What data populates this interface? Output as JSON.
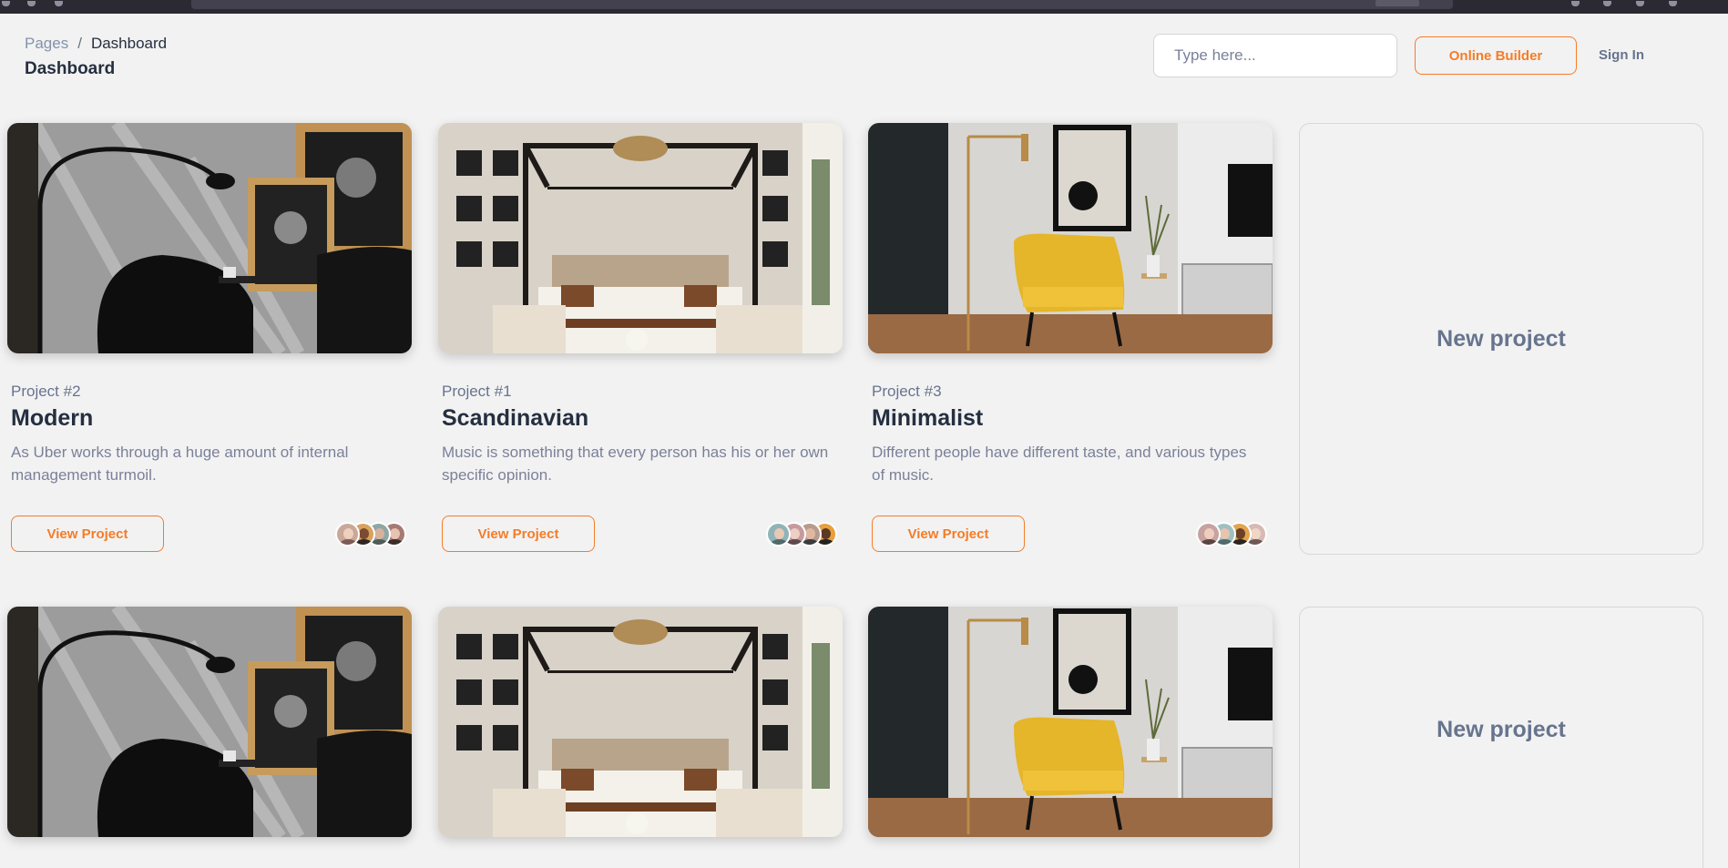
{
  "header": {
    "breadcrumb": {
      "parent": "Pages",
      "separator": "/",
      "current": "Dashboard"
    },
    "title": "Dashboard",
    "search_placeholder": "Type here...",
    "builder_label": "Online Builder",
    "signin_label": "Sign In"
  },
  "colors": {
    "accent": "#f57c27",
    "background": "#f2f2f2",
    "heading": "#252f40",
    "muted": "#7b809a"
  },
  "projects": [
    {
      "number": "Project #2",
      "name": "Modern",
      "description": "As Uber works through a huge amount of internal management turmoil.",
      "button": "View Project",
      "image": "modern-living-room-image",
      "avatars": [
        "#c9a89a",
        "#d9a25c",
        "#8fa7a4",
        "#a67a74"
      ]
    },
    {
      "number": "Project #1",
      "name": "Scandinavian",
      "description": "Music is something that every person has his or her own specific opinion.",
      "button": "View Project",
      "image": "scandinavian-bedroom-image",
      "avatars": [
        "#8fb4b8",
        "#c59b9e",
        "#b79a8e",
        "#e7a13a"
      ]
    },
    {
      "number": "Project #3",
      "name": "Minimalist",
      "description": "Different people have different taste, and various types of music.",
      "button": "View Project",
      "image": "minimalist-yellow-chair-image",
      "avatars": [
        "#c6a3a0",
        "#9ec0c0",
        "#e3a44d",
        "#d7b9b6"
      ]
    }
  ],
  "new_project_label": "New project"
}
